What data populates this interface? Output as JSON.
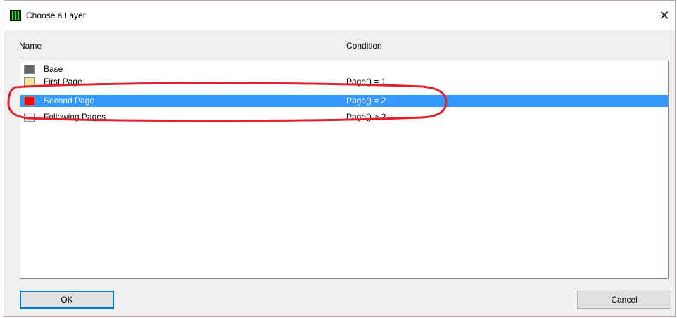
{
  "window": {
    "title": "Choose a Layer",
    "close_glyph": "✕"
  },
  "columns": {
    "name": "Name",
    "condition": "Condition"
  },
  "layers": [
    {
      "name": "Base",
      "condition": "",
      "color": "#646464",
      "selected": false
    },
    {
      "name": "First Page",
      "condition": "Page() = 1",
      "color": "#f0e6a0",
      "selected": false
    },
    {
      "name": "Second Page",
      "condition": "Page() = 2",
      "color": "#ff0000",
      "selected": true
    },
    {
      "name": "Following Pages",
      "condition": "Page() > 2",
      "color": "#e8eef8",
      "selected": false
    }
  ],
  "buttons": {
    "ok": "OK",
    "cancel": "Cancel"
  },
  "colors": {
    "selection": "#3399ff",
    "annotation": "#e0202a",
    "default_button_border": "#0078d7"
  }
}
